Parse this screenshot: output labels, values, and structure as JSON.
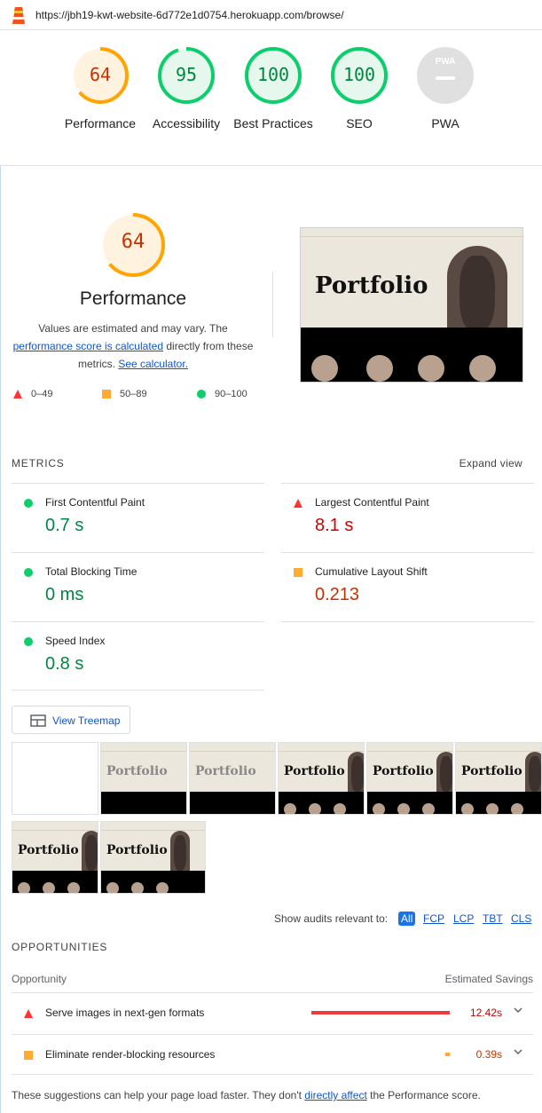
{
  "browser": {
    "url": "https://jbh19-kwt-website-6d772e1d0754.herokuapp.com/browse/"
  },
  "categories": [
    {
      "label": "Performance",
      "score": "64"
    },
    {
      "label": "Accessibility",
      "score": "95"
    },
    {
      "label": "Best Practices",
      "score": "100"
    },
    {
      "label": "SEO",
      "score": "100"
    },
    {
      "label": "PWA",
      "score": "",
      "badge": "PWA"
    }
  ],
  "performance": {
    "score": "64",
    "title": "Performance",
    "desc_1": "Values are estimated and may vary. The",
    "desc_link": "performance score is calculated",
    "desc_2": "directly from these metrics.",
    "calc_link": "See calculator.",
    "legend": [
      {
        "range": "0–49",
        "color": "#ff3333"
      },
      {
        "range": "50–89",
        "color": "#ffaa33"
      },
      {
        "range": "90–100",
        "color": "#0cce6b"
      }
    ]
  },
  "screenshot": {
    "title": "Portfolio"
  },
  "metrics": {
    "header": "METRICS",
    "expand": "Expand view",
    "items": [
      {
        "label": "First Contentful Paint",
        "value": "0.7 s",
        "rating": "good"
      },
      {
        "label": "Largest Contentful Paint",
        "value": "8.1 s",
        "rating": "bad"
      },
      {
        "label": "Total Blocking Time",
        "value": "0 ms",
        "rating": "good"
      },
      {
        "label": "Cumulative Layout Shift",
        "value": "0.213",
        "rating": "average"
      },
      {
        "label": "Speed Index",
        "value": "0.8 s",
        "rating": "good"
      }
    ]
  },
  "treemap": {
    "label": "View Treemap"
  },
  "filmstrip": {
    "frame_title": "Portfolio"
  },
  "filter": {
    "label": "Show audits relevant to:",
    "chips": [
      "All",
      "FCP",
      "LCP",
      "TBT",
      "CLS"
    ]
  },
  "opportunities": {
    "header": "OPPORTUNITIES",
    "col_left": "Opportunity",
    "col_right": "Estimated Savings",
    "items": [
      {
        "label": "Serve images in next-gen formats",
        "value": "12.42s",
        "rating": "bad",
        "fraction": 1.0
      },
      {
        "label": "Eliminate render-blocking resources",
        "value": "0.39s",
        "rating": "average",
        "fraction": 0.03
      }
    ]
  },
  "footer": {
    "text_1": "These suggestions can help your page load faster. They don't",
    "link": "directly affect",
    "text_2": "the Performance score."
  },
  "colors": {
    "good": "#0cce6b",
    "average": "#ffa400",
    "bad": "#ff4e42",
    "link": "#1155cc"
  }
}
